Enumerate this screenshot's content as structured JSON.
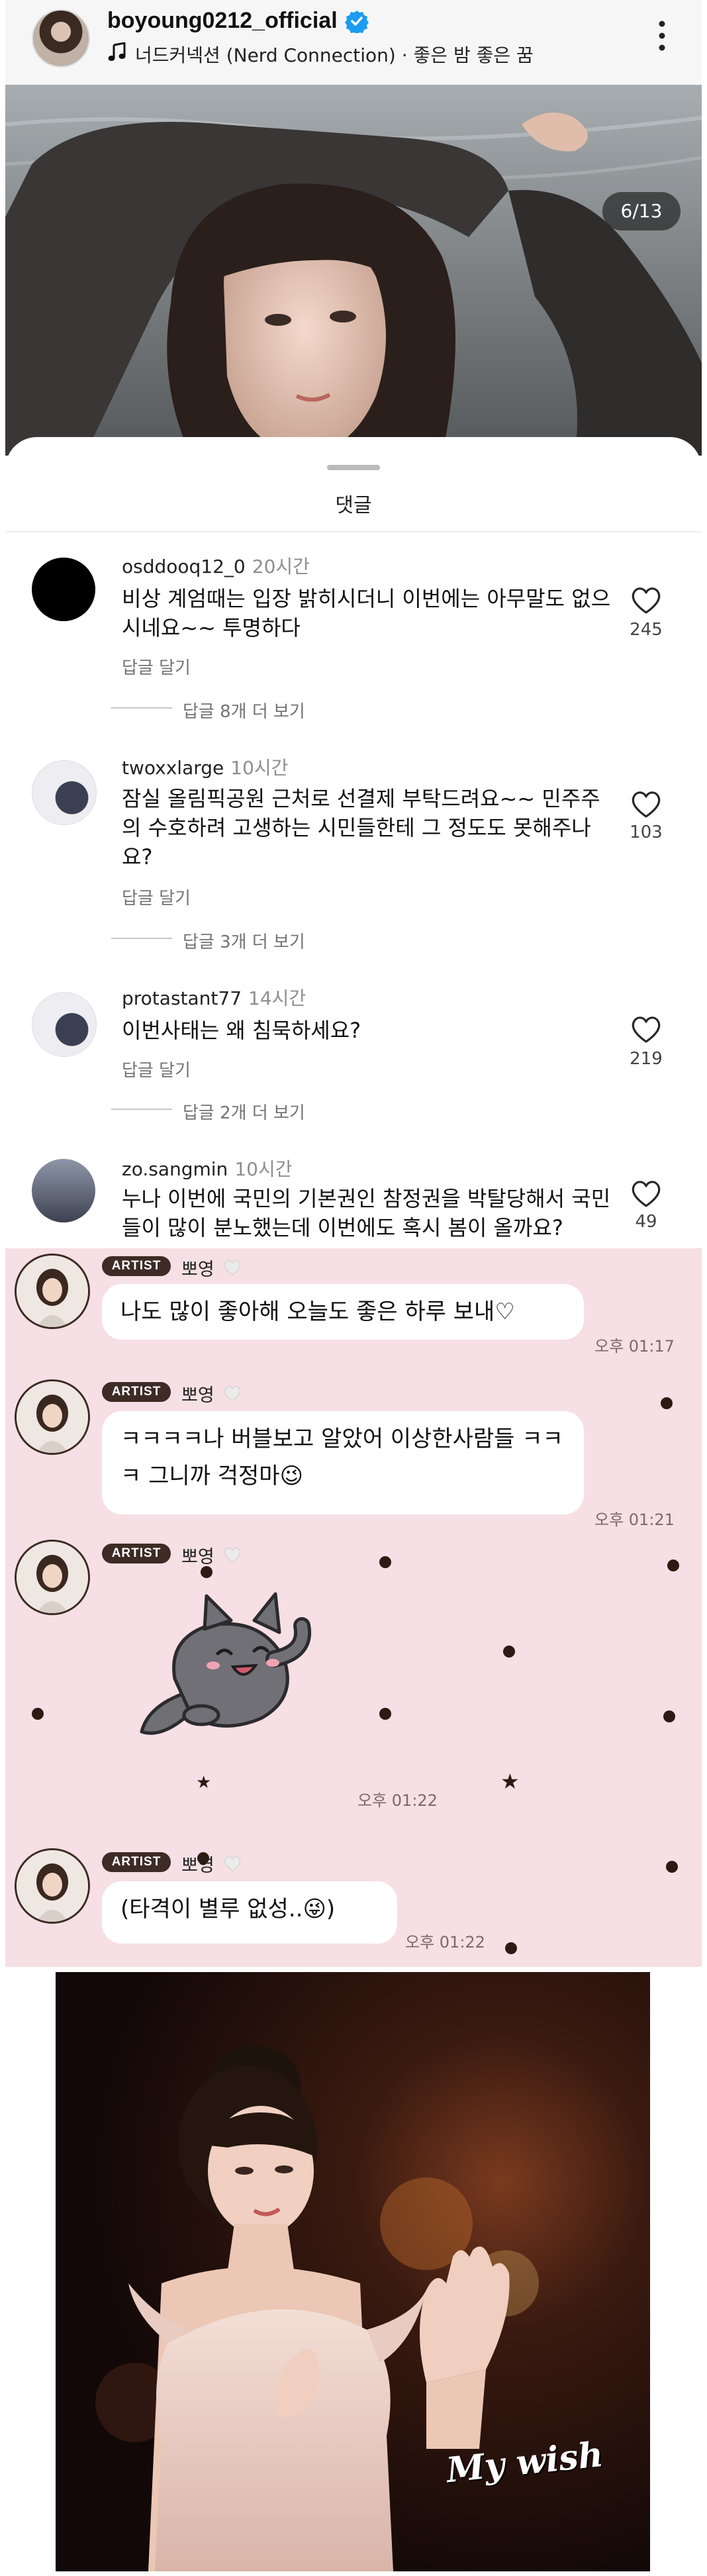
{
  "post": {
    "username": "boyoung0212_official",
    "music": "너드커넥션 (Nerd Connection) · 좋은 밤 좋은 꿈",
    "page_counter": "6/13"
  },
  "comments_sheet": {
    "title": "댓글",
    "comments": [
      {
        "user": "osddooq12_0",
        "time": "20시간",
        "text": "비상 계엄때는 입장 밝히시더니 이번에는 아무말도 없으시네요~~ 투명하다",
        "reply": "답글 달기",
        "likes": "245",
        "more_replies": "답글 8개 더 보기"
      },
      {
        "user": "twoxxlarge",
        "time": "10시간",
        "text": "잠실 올림픽공원 근처로 선결제 부탁드려요~~ 민주주의 수호하려 고생하는 시민들한테 그 정도도 못해주나요?",
        "reply": "답글 달기",
        "likes": "103",
        "more_replies": "답글 3개 더 보기"
      },
      {
        "user": "protastant77",
        "time": "14시간",
        "text": "이번사태는 왜 침묵하세요?",
        "reply": "답글 달기",
        "likes": "219",
        "more_replies": "답글 2개 더 보기"
      },
      {
        "user": "zo.sangmin",
        "time": "10시간",
        "text": "누나 이번에 국민의 기본권인 참정권을 박탈당해서 국민들이 많이 분노했는데 이번에도 혹시 봄이 올까요?",
        "likes": "49"
      }
    ]
  },
  "chat": {
    "messages": [
      {
        "badge": "ARTIST",
        "name": "뽀영",
        "text": "나도 많이 좋아해 오늘도 좋은 하루 보내♡",
        "time": "오후 01:17"
      },
      {
        "badge": "ARTIST",
        "name": "뽀영",
        "text": "ㅋㅋㅋㅋ나 버블보고 알았어 이상한사람들 ㅋㅋㅋ 그니까 걱정마😉",
        "time": "오후 01:21"
      },
      {
        "badge": "ARTIST",
        "name": "뽀영",
        "time": "오후 01:22"
      },
      {
        "badge": "ARTIST",
        "name": "뽀영",
        "text": "(타격이 별루 없성..😜)",
        "time": "오후 01:22"
      }
    ]
  },
  "photo": {
    "caption": "My wish"
  },
  "colors": {
    "chat_background": "#f6dfe5",
    "badge": "#3d2b25",
    "verified": "#1d9bf0"
  }
}
